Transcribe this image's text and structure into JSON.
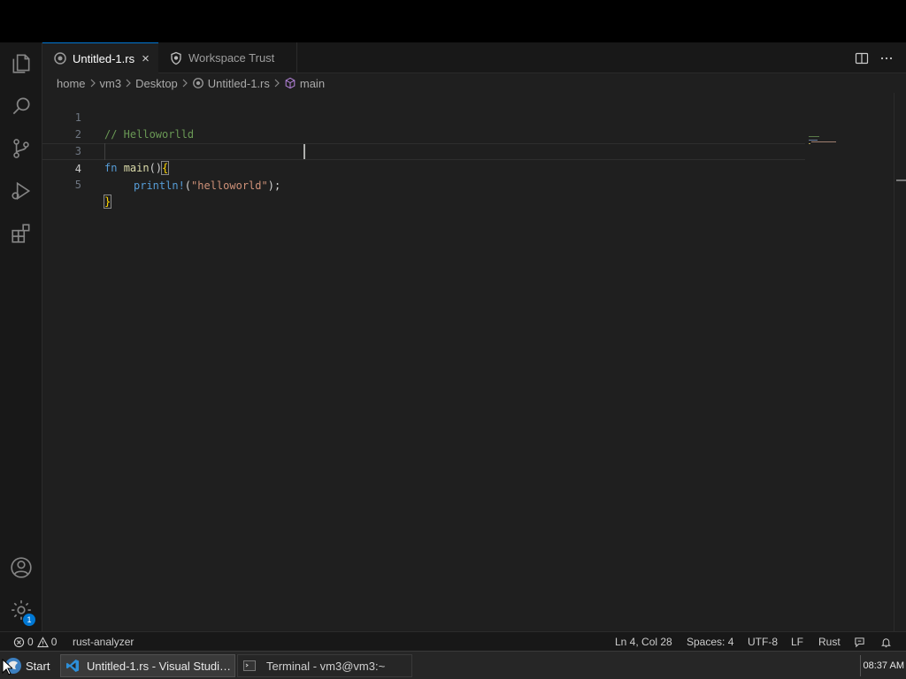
{
  "tabs": [
    {
      "label": "Untitled-1.rs",
      "icon": "rust-file-icon",
      "active": true
    },
    {
      "label": "Workspace Trust",
      "icon": "shield-icon",
      "active": false
    }
  ],
  "tab_close": "×",
  "breadcrumb": [
    "home",
    "vm3",
    "Desktop",
    "Untitled-1.rs",
    "main"
  ],
  "editor": {
    "lines": [
      {
        "num": "1",
        "comment": "// Helloworlld"
      },
      {
        "num": "2"
      },
      {
        "num": "3",
        "kw": "fn",
        "fn": "main",
        "parens": "()",
        "brace": "{"
      },
      {
        "num": "4",
        "macro": "println!",
        "open": "(",
        "str": "\"helloworld\"",
        "close": ");"
      },
      {
        "num": "5",
        "brace": "}"
      }
    ],
    "cursor_line": 4
  },
  "activity_bar": {
    "items": [
      "explorer-icon",
      "search-icon",
      "source-control-icon",
      "run-debug-icon",
      "extensions-icon"
    ],
    "bottom": [
      "account-icon",
      "manage-gear-icon"
    ],
    "manage_badge": "1"
  },
  "status": {
    "errors": "0",
    "warnings": "0",
    "language_server": "rust-analyzer",
    "position": "Ln 4, Col 28",
    "spaces": "Spaces: 4",
    "encoding": "UTF-8",
    "eol": "LF",
    "language": "Rust"
  },
  "taskbar": {
    "start": "Start",
    "task1": "Untitled-1.rs - Visual Studi…",
    "task2": "Terminal - vm3@vm3:~",
    "clock": "08:37 AM"
  },
  "colors": {
    "accent": "#0078d4",
    "comment": "#6a9955",
    "keyword": "#569cd6",
    "function": "#dcdcaa",
    "string": "#ce9178",
    "bracket": "#ffd700"
  }
}
